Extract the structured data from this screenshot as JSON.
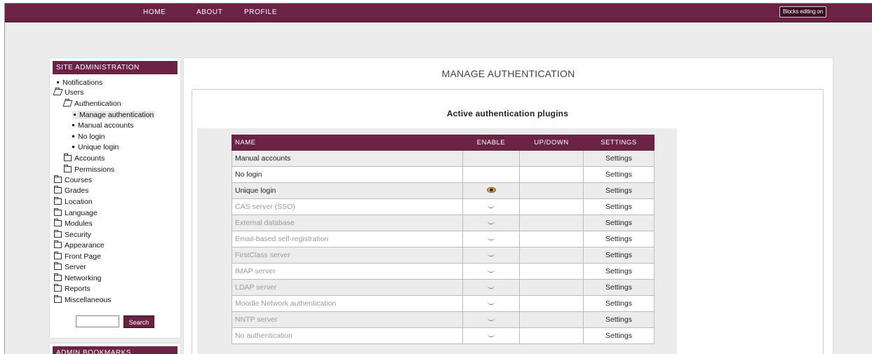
{
  "nav": {
    "home": "HOME",
    "about": "ABOUT",
    "profile": "PROFILE",
    "blocks_button": "Blocks editing on"
  },
  "sidebar": {
    "title": "SITE ADMINISTRATION",
    "items": [
      {
        "label": "Notifications",
        "icon": "bullet-icon"
      },
      {
        "label": "Users",
        "icon": "folder-open-icon"
      },
      {
        "label": "Authentication",
        "icon": "folder-open-icon"
      },
      {
        "label": "Manage authentication",
        "icon": "bullet-icon"
      },
      {
        "label": "Manual accounts",
        "icon": "bullet-icon"
      },
      {
        "label": "No login",
        "icon": "bullet-icon"
      },
      {
        "label": "Unique login",
        "icon": "bullet-icon"
      },
      {
        "label": "Accounts",
        "icon": "folder-icon"
      },
      {
        "label": "Permissions",
        "icon": "folder-icon"
      },
      {
        "label": "Courses",
        "icon": "folder-icon"
      },
      {
        "label": "Grades",
        "icon": "folder-icon"
      },
      {
        "label": "Location",
        "icon": "folder-icon"
      },
      {
        "label": "Language",
        "icon": "folder-icon"
      },
      {
        "label": "Modules",
        "icon": "folder-icon"
      },
      {
        "label": "Security",
        "icon": "folder-icon"
      },
      {
        "label": "Appearance",
        "icon": "folder-icon"
      },
      {
        "label": "Front Page",
        "icon": "folder-icon"
      },
      {
        "label": "Server",
        "icon": "folder-icon"
      },
      {
        "label": "Networking",
        "icon": "folder-icon"
      },
      {
        "label": "Reports",
        "icon": "folder-icon"
      },
      {
        "label": "Miscellaneous",
        "icon": "folder-icon"
      }
    ],
    "search_button": "Search",
    "bookmarks_title": "ADMIN BOOKMARKS"
  },
  "main": {
    "title": "MANAGE AUTHENTICATION",
    "subheading": "Active authentication plugins",
    "columns": [
      "NAME",
      "ENABLE",
      "UP/DOWN",
      "SETTINGS"
    ],
    "rows": [
      {
        "name": "Manual accounts",
        "enable": "",
        "settings": "Settings",
        "disabled": false
      },
      {
        "name": "No login",
        "enable": "",
        "settings": "Settings",
        "disabled": false
      },
      {
        "name": "Unique login",
        "enable": "eye-icon",
        "settings": "Settings",
        "disabled": false
      },
      {
        "name": "CAS server (SSO)",
        "enable": "closed-eye-icon",
        "settings": "Settings",
        "disabled": true
      },
      {
        "name": "External database",
        "enable": "closed-eye-icon",
        "settings": "Settings",
        "disabled": true
      },
      {
        "name": "Email-based self-registration",
        "enable": "closed-eye-icon",
        "settings": "Settings",
        "disabled": true
      },
      {
        "name": "FirstClass server",
        "enable": "closed-eye-icon",
        "settings": "Settings",
        "disabled": true
      },
      {
        "name": "IMAP server",
        "enable": "closed-eye-icon",
        "settings": "Settings",
        "disabled": true
      },
      {
        "name": "LDAP server",
        "enable": "closed-eye-icon",
        "settings": "Settings",
        "disabled": true
      },
      {
        "name": "Moodle Network authentication",
        "enable": "closed-eye-icon",
        "settings": "Settings",
        "disabled": true
      },
      {
        "name": "NNTP server",
        "enable": "closed-eye-icon",
        "settings": "Settings",
        "disabled": true
      },
      {
        "name": "No authentication",
        "enable": "closed-eye-icon",
        "settings": "Settings",
        "disabled": true
      }
    ]
  },
  "colors": {
    "brand": "#6b2245",
    "page_bg": "#ececec"
  }
}
